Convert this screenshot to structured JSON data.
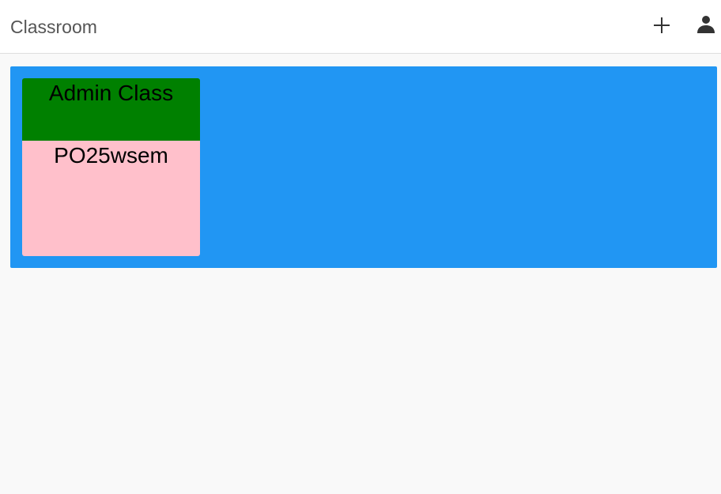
{
  "app_bar": {
    "title": "Classroom",
    "add_icon": "plus-icon",
    "account_icon": "person-icon"
  },
  "colors": {
    "app_bar_bg": "#ffffff",
    "page_bg": "#f9f9f9",
    "class_area_bg": "#2196f3",
    "card_header_bg": "#008000",
    "card_body_bg": "#ffc0cb"
  },
  "classes": [
    {
      "name": "Admin Class",
      "code": "PO25wsem"
    }
  ]
}
